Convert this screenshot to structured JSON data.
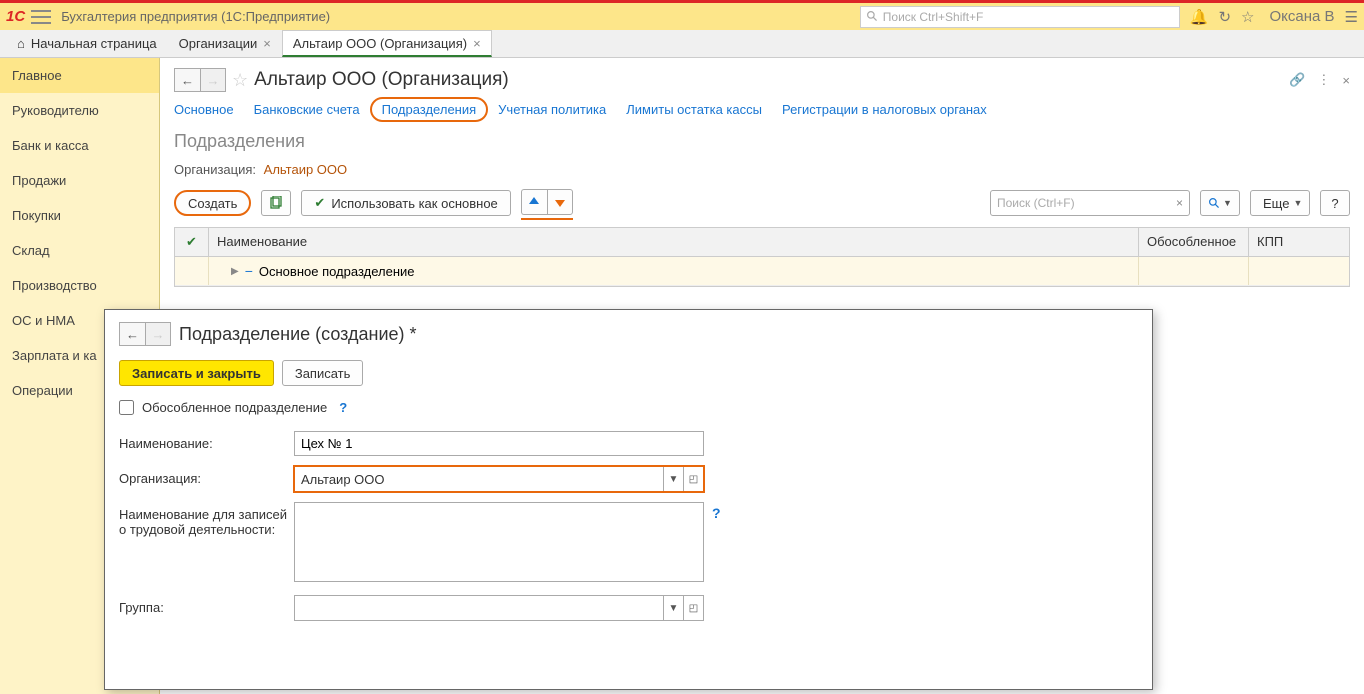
{
  "app": {
    "title": "Бухгалтерия предприятия  (1С:Предприятие)"
  },
  "title_search": {
    "placeholder": "Поиск Ctrl+Shift+F"
  },
  "user": {
    "name": "Оксана В"
  },
  "tabs": {
    "home": "Начальная страница",
    "t1": "Организации",
    "t2": "Альтаир ООО (Организация)"
  },
  "sidebar": {
    "main": "Главное",
    "leader": "Руководителю",
    "bank": "Банк и касса",
    "sales": "Продажи",
    "purchases": "Покупки",
    "warehouse": "Склад",
    "production": "Производство",
    "os": "ОС и НМА",
    "salary": "Зарплата и ка",
    "operations": "Операции"
  },
  "page": {
    "title": "Альтаир ООО (Организация)",
    "subtabs": {
      "main": "Основное",
      "bank": "Банковские счета",
      "dept": "Подразделения",
      "policy": "Учетная политика",
      "cash": "Лимиты остатка кассы",
      "tax": "Регистрации в налоговых органах"
    },
    "section": "Подразделения",
    "org_label": "Организация:",
    "org_value": "Альтаир ООО",
    "toolbar": {
      "create": "Создать",
      "use_main": "Использовать как основное",
      "search_placeholder": "Поиск (Ctrl+F)",
      "more": "Еще"
    },
    "table": {
      "h1": "Наименование",
      "h2": "Обособленное",
      "h3": "КПП",
      "row1": "Основное подразделение"
    }
  },
  "dialog": {
    "title": "Подразделение (создание) *",
    "save_close": "Записать и закрыть",
    "save": "Записать",
    "checkbox": "Обособленное подразделение",
    "name_label": "Наименование:",
    "name_value": "Цех № 1",
    "org_label": "Организация:",
    "org_value": "Альтаир ООО",
    "labor_label": "Наименование для записей о трудовой деятельности:",
    "group_label": "Группа:"
  }
}
